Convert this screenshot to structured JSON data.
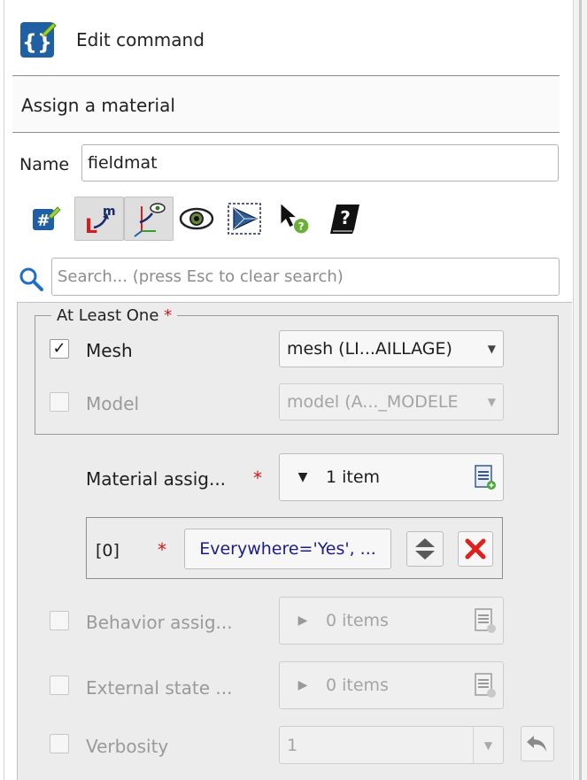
{
  "header": {
    "title": "Edit command",
    "icon": "edit-command-icon"
  },
  "subtitle": "Assign a material",
  "name_field": {
    "label": "Name",
    "value": "fieldmat"
  },
  "toolbar": {
    "buttons": [
      {
        "name": "hash-variable-icon",
        "pressed": false
      },
      {
        "name": "mesh-dims-icon",
        "pressed": true
      },
      {
        "name": "axis-eye-icon",
        "pressed": true
      },
      {
        "name": "eye-icon",
        "pressed": false
      },
      {
        "name": "mesh-3d-icon",
        "pressed": false
      },
      {
        "name": "cursor-help-icon",
        "pressed": false
      },
      {
        "name": "documentation-icon",
        "pressed": false
      }
    ]
  },
  "search": {
    "placeholder": "Search... (press Esc to clear search)",
    "value": ""
  },
  "group": {
    "title": "At Least One",
    "required_mark": "*",
    "mesh": {
      "label": "Mesh",
      "checked": true,
      "value": "mesh (LI...AILLAGE)"
    },
    "model": {
      "label": "Model",
      "checked": false,
      "value": "model (A..._MODELE"
    }
  },
  "material": {
    "label": "Material assig...",
    "required_mark": "*",
    "count": "1 item",
    "items": [
      {
        "index": "[0]",
        "required_mark": "*",
        "value": "Everywhere='Yes', ..."
      }
    ]
  },
  "behavior": {
    "label": "Behavior assig...",
    "count": "0 items"
  },
  "external_state": {
    "label": "External state ...",
    "count": "0 items"
  },
  "verbosity": {
    "label": "Verbosity",
    "value": "1"
  },
  "colors": {
    "required": "#d01818",
    "delete": "#e0201c",
    "link_text": "#1c1c8a",
    "icon_blue": "#1f5fa3"
  }
}
